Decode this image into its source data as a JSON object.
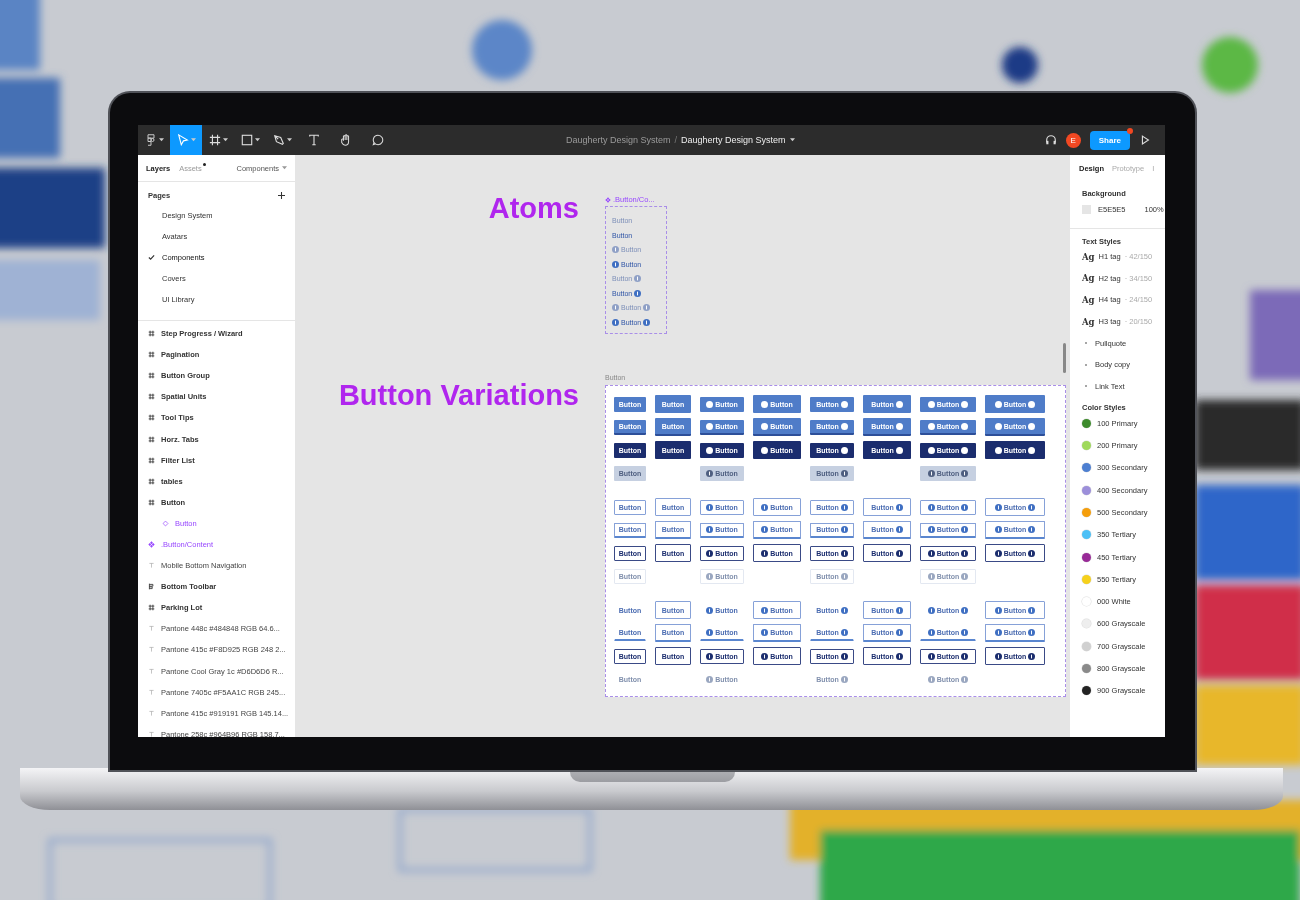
{
  "toolbar": {
    "tools": [
      {
        "kind": "main-menu",
        "selected": false
      },
      {
        "kind": "move",
        "selected": true
      },
      {
        "kind": "frame",
        "selected": false
      },
      {
        "kind": "shape",
        "selected": false
      },
      {
        "kind": "pen",
        "selected": false
      },
      {
        "kind": "text",
        "selected": false
      },
      {
        "kind": "hand",
        "selected": false
      },
      {
        "kind": "comment",
        "selected": false
      }
    ],
    "breadcrumb": {
      "team": "Daugherty Design System",
      "separator": "/",
      "file": "Daugherty Design System"
    },
    "avatar": "E",
    "share": {
      "label": "Share",
      "badge": true
    }
  },
  "left_panel": {
    "tabs": [
      {
        "label": "Layers",
        "selected": true,
        "badge": false
      },
      {
        "label": "Assets",
        "selected": false,
        "badge": true
      }
    ],
    "pages_menu": "Components",
    "pages": {
      "title": "Pages",
      "items": [
        {
          "label": "Design System",
          "checked": false
        },
        {
          "label": "Avatars",
          "checked": false
        },
        {
          "label": "Components",
          "checked": true
        },
        {
          "label": "Covers",
          "checked": false
        },
        {
          "label": "UI Library",
          "checked": false
        }
      ]
    },
    "layers": [
      {
        "label": "Step Progress / Wizard",
        "kind": "frame"
      },
      {
        "label": "Pagination",
        "kind": "frame"
      },
      {
        "label": "Button Group",
        "kind": "frame"
      },
      {
        "label": "Spatial Units",
        "kind": "frame"
      },
      {
        "label": "Tool Tips",
        "kind": "frame"
      },
      {
        "label": "Horz. Tabs",
        "kind": "frame"
      },
      {
        "label": "Filter List",
        "kind": "frame"
      },
      {
        "label": "tables",
        "kind": "frame"
      },
      {
        "label": "Button",
        "kind": "frame",
        "children": [
          {
            "label": "Button",
            "kind": "instance"
          }
        ]
      },
      {
        "label": ".Button/Content",
        "kind": "component"
      },
      {
        "label": "Mobile Bottom Navigation",
        "kind": "text"
      },
      {
        "label": "Bottom Toolbar",
        "kind": "autolayout"
      },
      {
        "label": "Parking Lot",
        "kind": "frame"
      },
      {
        "label": "Pantone 448c #484848 RGB 64.6...",
        "kind": "text"
      },
      {
        "label": "Pantone 415c #F8D925 RGB 248 2...",
        "kind": "text"
      },
      {
        "label": "Pantone Cool Gray 1c #D6D6D6 R...",
        "kind": "text"
      },
      {
        "label": "Pantone 7405c #F5AA1C RGB 245...",
        "kind": "text"
      },
      {
        "label": "Pantone 415c #919191 RGB 145.14...",
        "kind": "text"
      },
      {
        "label": "Pantone 258c #964B96 RGB 158.7...",
        "kind": "text"
      }
    ]
  },
  "canvas": {
    "atoms_heading": "Atoms",
    "variations_heading": "Button Variations",
    "atom_frame": {
      "title": ".Button/Co...",
      "items": [
        {
          "label": "Button",
          "faded": true
        },
        {
          "label": "Button",
          "faded": false
        },
        {
          "label": "Button",
          "faded": true
        },
        {
          "label": "Button",
          "faded": false
        },
        {
          "label": "Button",
          "faded": true
        },
        {
          "label": "Button",
          "faded": false
        },
        {
          "label": "Button",
          "faded": true
        },
        {
          "label": "Button",
          "faded": false
        }
      ]
    },
    "button_frame": {
      "title": "Button",
      "groups": [
        {
          "kind": "filled",
          "rows": [
            [
              "Button",
              "Button",
              "Button",
              "Button",
              "Button",
              "Button",
              "Button",
              "Button"
            ],
            [
              "Button",
              "Button",
              "Button",
              "Button",
              "Button",
              "Button",
              "Button",
              "Button"
            ],
            [
              "Button",
              "Button",
              "Button",
              "Button",
              "Button",
              "Button",
              "Button",
              "Button"
            ],
            [
              "Button",
              "",
              "Button",
              "",
              "Button",
              "",
              "Button"
            ]
          ]
        },
        {
          "kind": "outline",
          "rows": [
            [
              "Button",
              "Button",
              "Button",
              "Button",
              "Button",
              "Button",
              "Button",
              "Button"
            ],
            [
              "Button",
              "Button",
              "Button",
              "Button",
              "Button",
              "Button",
              "Button",
              "Button"
            ],
            [
              "Button",
              "Button",
              "Button",
              "Button",
              "Button",
              "Button",
              "Button",
              "Button"
            ],
            [
              "Button",
              "",
              "Button",
              "",
              "Button",
              "",
              "Button"
            ]
          ]
        },
        {
          "kind": "text",
          "rows": [
            [
              "Button",
              "Button",
              "Button",
              "Button",
              "Button",
              "Button",
              "Button",
              "Button"
            ],
            [
              "Button",
              "Button",
              "Button",
              "Button",
              "Button",
              "Button",
              "Button",
              "Button"
            ],
            [
              "Button",
              "Button",
              "Button",
              "Button",
              "Button",
              "Button",
              "Button",
              "Button"
            ],
            [
              "Button",
              "",
              "Button",
              "",
              "Button",
              "",
              "Button"
            ]
          ]
        }
      ]
    }
  },
  "right_panel": {
    "tabs": [
      {
        "label": "Design",
        "selected": true
      },
      {
        "label": "Prototype",
        "selected": false
      },
      {
        "label": "I",
        "selected": false
      }
    ],
    "background": {
      "title": "Background",
      "hex": "E5E5E5",
      "opacity": "100%"
    },
    "text_styles": {
      "title": "Text Styles",
      "items": [
        {
          "kind": "heading",
          "sample": "Ag",
          "name": "H1 tag",
          "spec": "· 42/150"
        },
        {
          "kind": "heading",
          "sample": "Ag",
          "name": "H2 tag",
          "spec": "· 34/150"
        },
        {
          "kind": "heading",
          "sample": "Ag",
          "name": "H4 tag",
          "spec": "· 24/150"
        },
        {
          "kind": "heading",
          "sample": "Ag",
          "name": "H3 tag",
          "spec": "· 20/150"
        },
        {
          "kind": "paragraph",
          "name": "Pullquote"
        },
        {
          "kind": "paragraph",
          "name": "Body copy"
        },
        {
          "kind": "paragraph",
          "name": "Link Text"
        }
      ]
    },
    "color_styles": {
      "title": "Color Styles",
      "items": [
        {
          "name": "100 Primary",
          "color": "#3d8b2c"
        },
        {
          "name": "200 Primary",
          "color": "#9fd95b"
        },
        {
          "name": "300 Secondary",
          "color": "#4d7fd1"
        },
        {
          "name": "400 Secondary",
          "color": "#9c8fda"
        },
        {
          "name": "500 Secondary",
          "color": "#f59e0b"
        },
        {
          "name": "350 Tertiary",
          "color": "#4cc0f6"
        },
        {
          "name": "450 Tertiary",
          "color": "#982a97"
        },
        {
          "name": "550 Tertiary",
          "color": "#f6d11b"
        },
        {
          "name": "000 White",
          "color": "#ffffff"
        },
        {
          "name": "600 Grayscale",
          "color": "#eeeeee"
        },
        {
          "name": "700 Grayscale",
          "color": "#d0d0d0"
        },
        {
          "name": "800 Grayscale",
          "color": "#8a8a8a"
        },
        {
          "name": "900 Grayscale",
          "color": "#222222"
        }
      ]
    }
  }
}
